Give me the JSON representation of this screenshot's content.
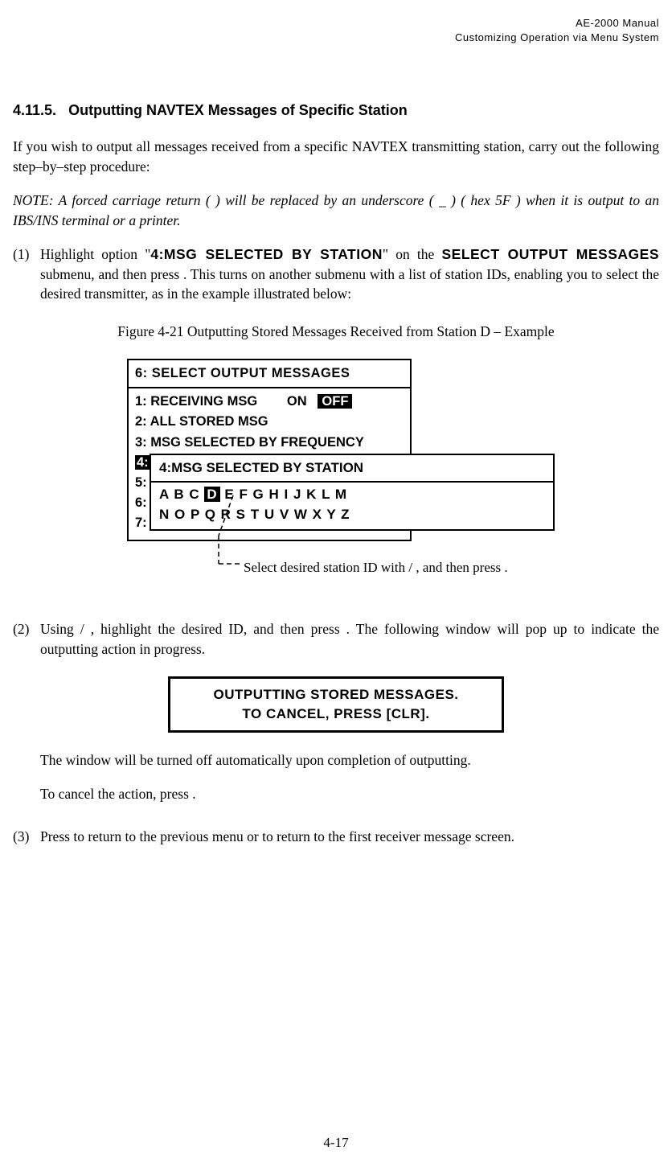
{
  "header": {
    "line1": "AE-2000 Manual",
    "line2": "Customizing Operation via Menu System"
  },
  "section": {
    "number": "4.11.5.",
    "title": "Outputting NAVTEX Messages of Specific Station"
  },
  "intro": "If you wish to output all messages received from a specific NAVTEX transmitting station, carry out the following step–by–step procedure:",
  "note_pre": "NOTE: A forced carriage return ( ",
  "note_post": " ) will be replaced by an underscore ( _ ) ( hex 5F ) when it is output to an IBS/INS terminal or a printer.",
  "step1": {
    "num": "(1)",
    "a": " Highlight option \"",
    "b": "4:MSG SELECTED BY STATION",
    "c": "\" on the ",
    "d": "SELECT OUTPUT MESSAGES",
    "e": " submenu, and then press ",
    "f": ". This turns on another submenu with a list of station IDs, enabling you to select the desired transmitter, as in the example illustrated below:"
  },
  "figcap": "Figure 4-21   Outputting Stored Messages Received from Station D – Example",
  "menu": {
    "title": "6: SELECT OUTPUT MESSAGES",
    "l1a": "1: RECEIVING MSG",
    "l1b": "ON",
    "l1c": "OFF",
    "l2": "2: ALL STORED MSG",
    "l3": "3: MSG SELECTED BY FREQUENCY",
    "l4": "4: MSG SELECTED BY STATION",
    "l5": "5:",
    "l6": "6:",
    "l7": "7:"
  },
  "popup": {
    "title": "4:MSG SELECTED BY STATION",
    "row1_pre": "A   B   C   ",
    "row1_hl": "D",
    "row1_post": "   E   F   G   H   I   J   K   L   M",
    "row2": "N   O   P   Q  R    S   T   U  V  W  X   Y  Z"
  },
  "annotation": {
    "a": "Select desired station ID with ",
    "slash": " / ",
    "b": " , and then press ",
    "dot": "."
  },
  "step2": {
    "num": "(2)",
    "a": " Using ",
    "slash": " / ",
    "b": " , highlight the desired ID, and then press ",
    "c": ". The following window will pop up to indicate the outputting action in progress."
  },
  "dialog": {
    "l1": "OUTPUTTING STORED MESSAGES.",
    "l2": "TO CANCEL, PRESS [CLR]."
  },
  "post2a": "The window will be turned off automatically upon completion of outputting.",
  "post2b_a": "To cancel the action, press ",
  "post2b_b": " .",
  "step3": {
    "num": "(3)",
    "a": " Press ",
    "b": " to return to the previous menu or ",
    "c": " to return to the first receiver message screen."
  },
  "pagenum": "4-17"
}
